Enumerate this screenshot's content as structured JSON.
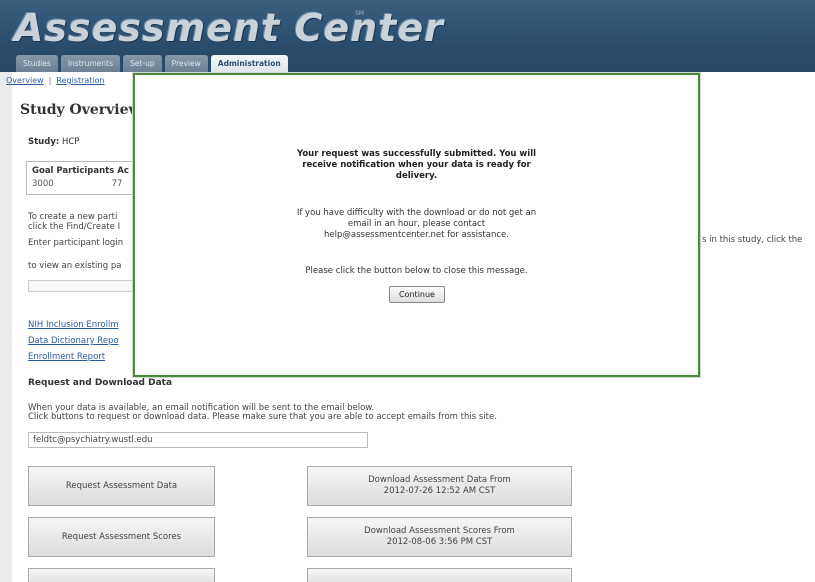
{
  "header": {
    "app_title": "Assessment Center",
    "trademark": "SM",
    "tabs": [
      {
        "label": "Studies"
      },
      {
        "label": "Instruments"
      },
      {
        "label": "Set-up"
      },
      {
        "label": "Preview"
      },
      {
        "label": "Administration",
        "active": true
      }
    ]
  },
  "subnav": {
    "overview": "Overview",
    "registration": "Registration"
  },
  "page": {
    "title": "Study Overview",
    "study_label": "Study:",
    "study_value": "HCP",
    "goal_label": "Goal Participants Ac",
    "goal_value": "3000",
    "actual_value": "77",
    "para1_line1": "To create a new parti",
    "para1_line2": "click the Find/Create I",
    "para2": "Enter participant login",
    "para3": "to view an existing pa",
    "side_text": "s in this study, click the",
    "links": [
      "NIH Inclusion Enrollm",
      "Data Dictionary Repo",
      "Enrollment Report"
    ],
    "request_title": "Request and Download Data",
    "request_line1": "When your data is available, an email notification will be sent to the email below.",
    "request_line2": "Click buttons to request or download data. Please make sure that you are able to accept emails from this site.",
    "email_value": "feldtc@psychiatry.wustl.edu",
    "buttons": {
      "request_data": "Request Assessment Data",
      "download_data_l1": "Download Assessment Data From",
      "download_data_l2": "2012-07-26 12:52 AM CST",
      "request_scores": "Request Assessment Scores",
      "download_scores_l1": "Download Assessment Scores From",
      "download_scores_l2": "2012-08-06 3:56 PM CST"
    }
  },
  "modal": {
    "msg_line1": "Your request was successfully submitted. You will",
    "msg_line2": "receive notification when your data is ready for",
    "msg_line3": "delivery.",
    "help_line1": "If you have difficulty with the download or do not get an",
    "help_line2": "email in an hour, please contact",
    "help_line3": "help@assessmentcenter.net for assistance.",
    "close_note": "Please click the button below to close this message.",
    "continue_label": "Continue"
  },
  "colors": {
    "header_bg": "#2a4d6c",
    "modal_border": "#4a8a3c",
    "link": "#2c5aa0"
  }
}
